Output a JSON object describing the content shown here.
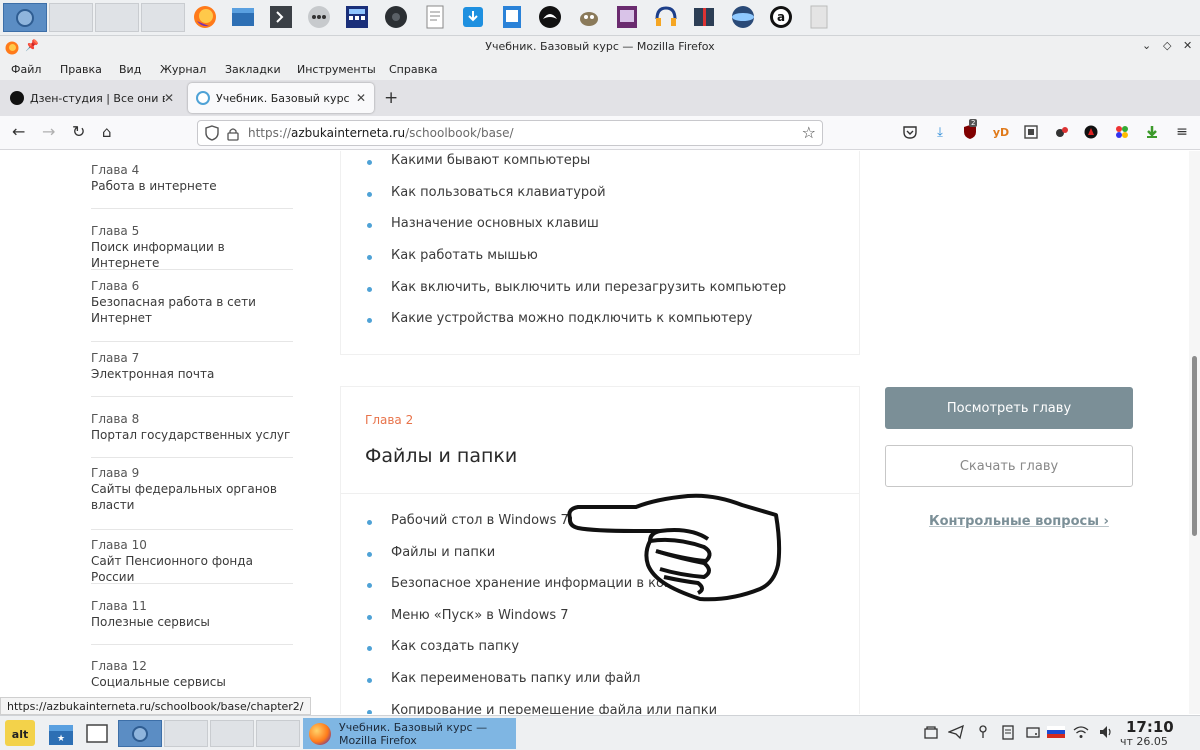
{
  "window": {
    "title": "Учебник. Базовый курс — Mozilla Firefox"
  },
  "menu": [
    "Файл",
    "Правка",
    "Вид",
    "Журнал",
    "Закладки",
    "Инструменты",
    "Справка"
  ],
  "tabs": [
    {
      "label": "Дзен-студия | Все они вы",
      "active": false
    },
    {
      "label": "Учебник. Базовый курс",
      "active": true
    }
  ],
  "address": {
    "scheme": "https://",
    "host": "azbukainterneta.ru",
    "path": "/schoolbook/base/"
  },
  "extensions": {
    "badge_count": "2",
    "yd_label": "yD"
  },
  "sidebar": {
    "chapters": [
      {
        "num": "Глава 4",
        "title": "Работа в интернете"
      },
      {
        "num": "Глава 5",
        "title": "Поиск информации в Интернете"
      },
      {
        "num": "Глава 6",
        "title": "Безопасная работа в сети Интернет"
      },
      {
        "num": "Глава 7",
        "title": "Электронная почта"
      },
      {
        "num": "Глава 8",
        "title": "Портал государственных услуг"
      },
      {
        "num": "Глава 9",
        "title": "Сайты федеральных органов власти"
      },
      {
        "num": "Глава 10",
        "title": "Сайт Пенсионного фонда России"
      },
      {
        "num": "Глава 11",
        "title": "Полезные сервисы"
      },
      {
        "num": "Глава 12",
        "title": "Социальные сервисы"
      }
    ]
  },
  "chapter1": {
    "topics": [
      "Какими бывают компьютеры",
      "Как пользоваться клавиатурой",
      "Назначение основных клавиш",
      "Как работать мышью",
      "Как включить, выключить или перезагрузить компьютер",
      "Какие устройства можно подключить к компьютеру"
    ]
  },
  "chapter2": {
    "label": "Глава 2",
    "title": "Файлы и папки",
    "topics": [
      "Рабочий стол в Windows 7",
      "Файлы и папки",
      "Безопасное хранение информации в компьютере",
      "Меню «Пуск» в Windows 7",
      "Как создать папку",
      "Как переименовать папку или файл",
      "Копирование и перемещение файла или папки"
    ],
    "view_button": "Посмотреть главу",
    "download_button": "Скачать главу",
    "questions_link": "Контрольные вопросы ›"
  },
  "status_link": "https://azbukainterneta.ru/schoolbook/base/chapter2/",
  "taskbar": {
    "start_label": "alt",
    "active_window": "Учебник. Базовый курс — Mozilla Firefox",
    "time": "17:10",
    "date": "чт 26.05"
  },
  "colors": {
    "accent_orange": "#e8734a",
    "bullet_blue": "#4fa2d6",
    "button_gray": "#7b8f97"
  }
}
